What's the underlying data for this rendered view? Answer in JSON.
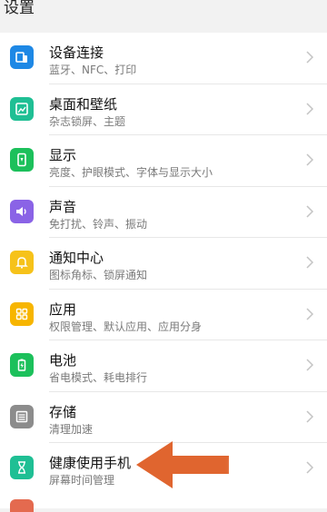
{
  "header": {
    "title": "设置"
  },
  "items": [
    {
      "title": "设备连接",
      "subtitle": "蓝牙、NFC、打印",
      "icon": "device-connect-icon",
      "color": "#1e88e5"
    },
    {
      "title": "桌面和壁纸",
      "subtitle": "杂志锁屏、主题",
      "icon": "wallpaper-icon",
      "color": "#1fbf94"
    },
    {
      "title": "显示",
      "subtitle": "亮度、护眼模式、字体与显示大小",
      "icon": "display-icon",
      "color": "#1cc05b"
    },
    {
      "title": "声音",
      "subtitle": "免打扰、铃声、振动",
      "icon": "sound-icon",
      "color": "#8a63e6"
    },
    {
      "title": "通知中心",
      "subtitle": "图标角标、锁屏通知",
      "icon": "bell-icon",
      "color": "#f6c21a"
    },
    {
      "title": "应用",
      "subtitle": "权限管理、默认应用、应用分身",
      "icon": "apps-icon",
      "color": "#f7b500"
    },
    {
      "title": "电池",
      "subtitle": "省电模式、耗电排行",
      "icon": "battery-icon",
      "color": "#1cc05b"
    },
    {
      "title": "存储",
      "subtitle": "清理加速",
      "icon": "storage-icon",
      "color": "#8c8c8c"
    },
    {
      "title": "健康使用手机",
      "subtitle": "屏幕时间管理",
      "icon": "hourglass-icon",
      "color": "#1fbf94"
    }
  ],
  "annotation": {
    "arrow_color": "#e0652f"
  }
}
